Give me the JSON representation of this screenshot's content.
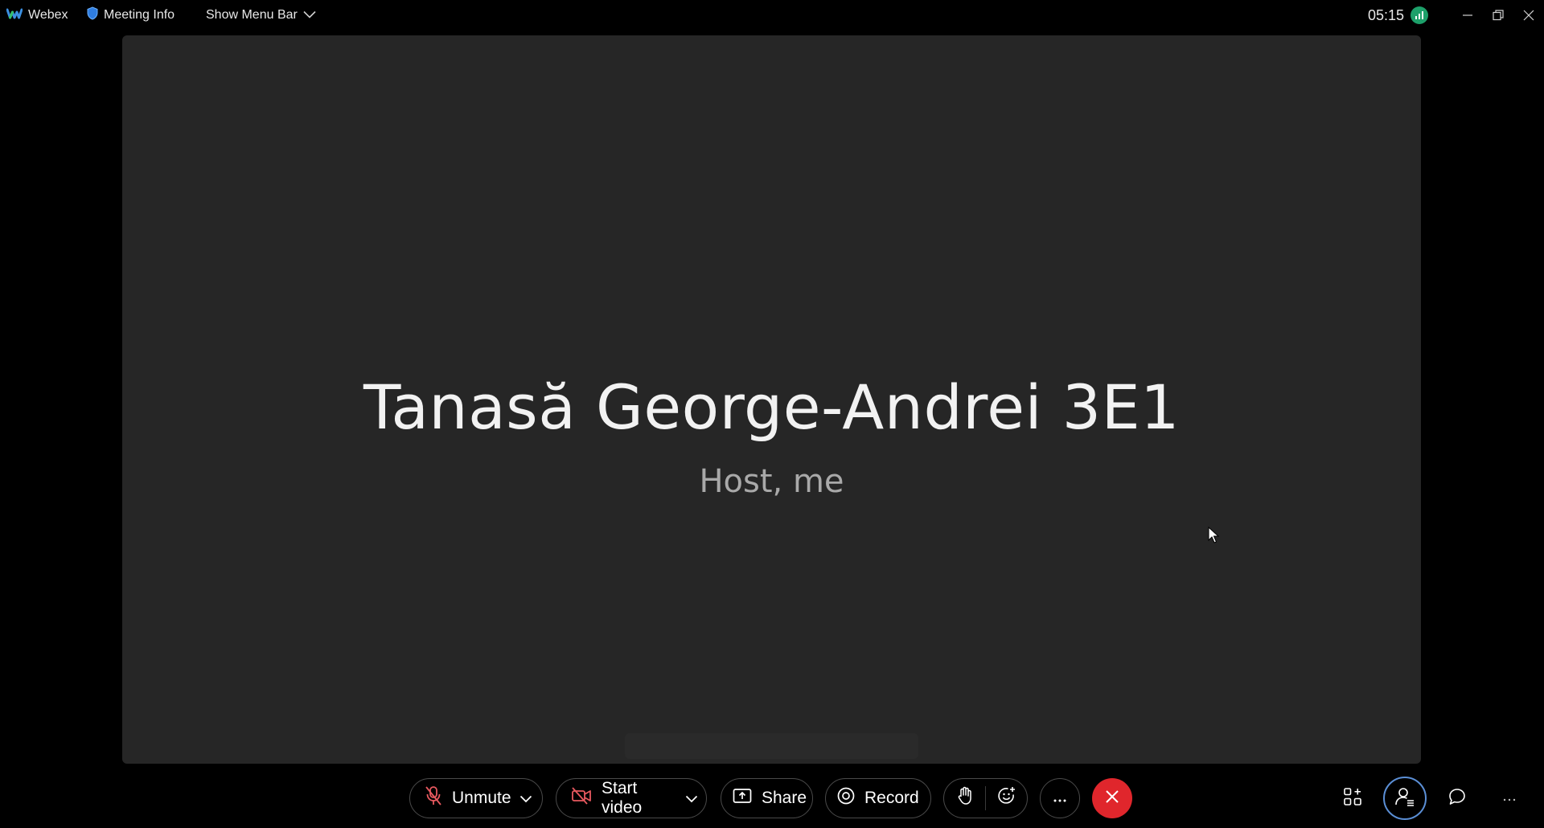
{
  "topbar": {
    "app_name": "Webex",
    "meeting_info_label": "Meeting Info",
    "menu_bar_label": "Show Menu Bar",
    "clock": "05:15"
  },
  "stage": {
    "participant_name": "Tanasă George-Andrei 3E1",
    "participant_role": "Host, me"
  },
  "controls": {
    "unmute_label": "Unmute",
    "start_video_label": "Start video",
    "share_label": "Share",
    "record_label": "Record"
  },
  "colors": {
    "background": "#000000",
    "stage": "#262626",
    "leave_red": "#e0262c",
    "muted_red": "#e8595f",
    "signal_green": "#1da06a",
    "focus_blue": "#5b8fd6"
  },
  "icons": {
    "app": "webex-logo-icon",
    "meeting_info": "shield-icon",
    "menu": "chevron-down-icon",
    "signal": "signal-bars-icon",
    "mic": "mic-off-icon",
    "video": "video-off-icon",
    "share": "share-icon",
    "record": "record-icon",
    "hand": "raise-hand-icon",
    "reactions": "emoji-icon",
    "more": "more-icon",
    "leave": "close-icon",
    "apps": "apps-icon",
    "participants": "participants-icon",
    "chat": "chat-icon"
  }
}
